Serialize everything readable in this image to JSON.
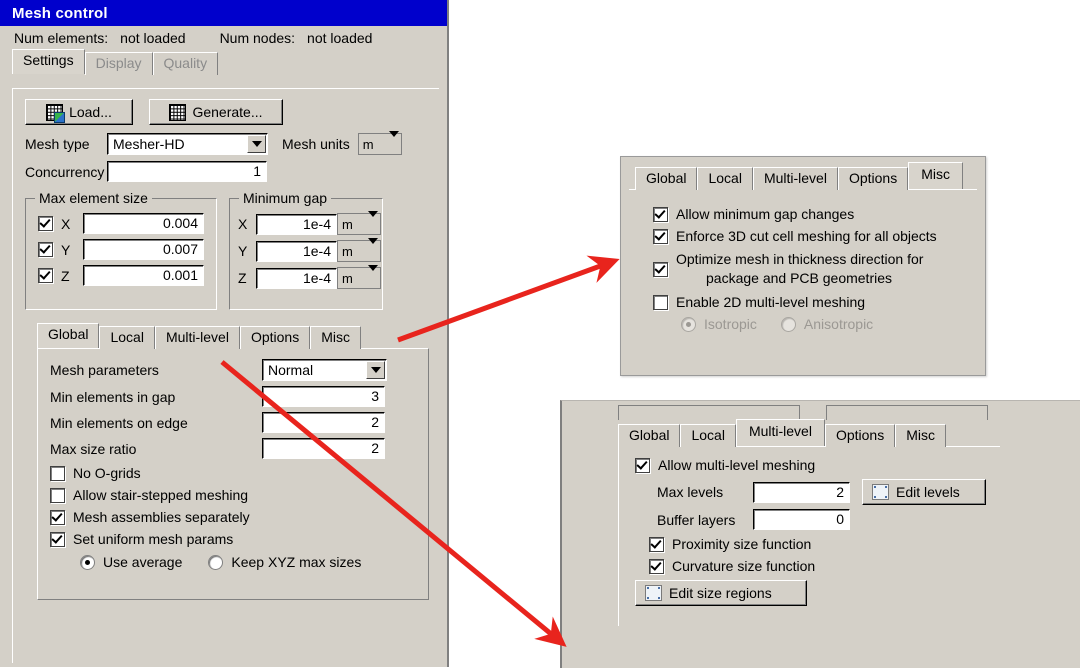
{
  "mesh_control": {
    "title": "Mesh control",
    "status": {
      "num_elements_label": "Num elements:",
      "num_elements_value": "not loaded",
      "num_nodes_label": "Num nodes:",
      "num_nodes_value": "not loaded"
    },
    "top_tabs": [
      {
        "label": "Settings",
        "state": "active"
      },
      {
        "label": "Display",
        "state": "disabled"
      },
      {
        "label": "Quality",
        "state": "disabled"
      }
    ],
    "buttons": {
      "load": "Load...",
      "generate": "Generate..."
    },
    "mesh_type": {
      "label": "Mesh type",
      "value": "Mesher-HD"
    },
    "mesh_units": {
      "label": "Mesh units",
      "value": "m"
    },
    "concurrency": {
      "label": "Concurrency",
      "value": "1"
    },
    "max_element_size": {
      "title": "Max element size",
      "rows": [
        {
          "axis": "X",
          "checked": true,
          "value": "0.004"
        },
        {
          "axis": "Y",
          "checked": true,
          "value": "0.007"
        },
        {
          "axis": "Z",
          "checked": true,
          "value": "0.001"
        }
      ]
    },
    "minimum_gap": {
      "title": "Minimum gap",
      "rows": [
        {
          "axis": "X",
          "value": "1e-4",
          "unit": "m"
        },
        {
          "axis": "Y",
          "value": "1e-4",
          "unit": "m"
        },
        {
          "axis": "Z",
          "value": "1e-4",
          "unit": "m"
        }
      ]
    },
    "sub_tabs": [
      {
        "label": "Global",
        "state": "active"
      },
      {
        "label": "Local",
        "state": "normal"
      },
      {
        "label": "Multi-level",
        "state": "normal"
      },
      {
        "label": "Options",
        "state": "normal"
      },
      {
        "label": "Misc",
        "state": "normal"
      }
    ],
    "global_tab": {
      "mesh_parameters": {
        "label": "Mesh parameters",
        "value": "Normal"
      },
      "min_elements_in_gap": {
        "label": "Min elements in gap",
        "value": "3"
      },
      "min_elements_on_edge": {
        "label": "Min elements on edge",
        "value": "2"
      },
      "max_size_ratio": {
        "label": "Max size ratio",
        "value": "2"
      },
      "checkboxes": [
        {
          "label": "No O-grids",
          "checked": false
        },
        {
          "label": "Allow stair-stepped meshing",
          "checked": false
        },
        {
          "label": "Mesh assemblies separately",
          "checked": true
        },
        {
          "label": "Set uniform mesh params",
          "checked": true
        }
      ],
      "radios": [
        {
          "label": "Use average",
          "checked": true
        },
        {
          "label": "Keep XYZ max sizes",
          "checked": false
        }
      ]
    }
  },
  "misc_panel": {
    "tabs": [
      {
        "label": "Global",
        "state": "normal"
      },
      {
        "label": "Local",
        "state": "normal"
      },
      {
        "label": "Multi-level",
        "state": "normal"
      },
      {
        "label": "Options",
        "state": "normal"
      },
      {
        "label": "Misc",
        "state": "active"
      }
    ],
    "checkboxes": [
      {
        "label": "Allow minimum gap changes",
        "checked": true
      },
      {
        "label": "Enforce 3D cut cell meshing for all objects",
        "checked": true
      },
      {
        "label": "Optimize mesh in thickness direction for",
        "label2": "package and PCB geometries",
        "checked": true
      },
      {
        "label": "Enable 2D multi-level meshing",
        "checked": false
      }
    ],
    "radios": [
      {
        "label": "Isotropic",
        "checked": true,
        "disabled": true
      },
      {
        "label": "Anisotropic",
        "checked": false,
        "disabled": true
      }
    ]
  },
  "multilevel_panel": {
    "tabs": [
      {
        "label": "Global",
        "state": "normal"
      },
      {
        "label": "Local",
        "state": "normal"
      },
      {
        "label": "Multi-level",
        "state": "active"
      },
      {
        "label": "Options",
        "state": "normal"
      },
      {
        "label": "Misc",
        "state": "normal"
      }
    ],
    "allow_multilevel": {
      "label": "Allow multi-level meshing",
      "checked": true
    },
    "max_levels": {
      "label": "Max levels",
      "value": "2"
    },
    "buffer_layers": {
      "label": "Buffer layers",
      "value": "0"
    },
    "edit_levels_button": "Edit levels",
    "checkboxes": [
      {
        "label": "Proximity size function",
        "checked": true
      },
      {
        "label": "Curvature size function",
        "checked": true
      }
    ],
    "edit_size_regions_button": "Edit size regions"
  },
  "annotations": {
    "arrow_color": "#e8241d",
    "arrows": [
      {
        "name": "misc-tab-to-misc-panel",
        "from": [
          398,
          340
        ],
        "to": [
          618,
          262
        ]
      },
      {
        "name": "multilevel-tab-to-multilevel-panel",
        "from": [
          222,
          362
        ],
        "to": [
          566,
          646
        ]
      }
    ]
  }
}
